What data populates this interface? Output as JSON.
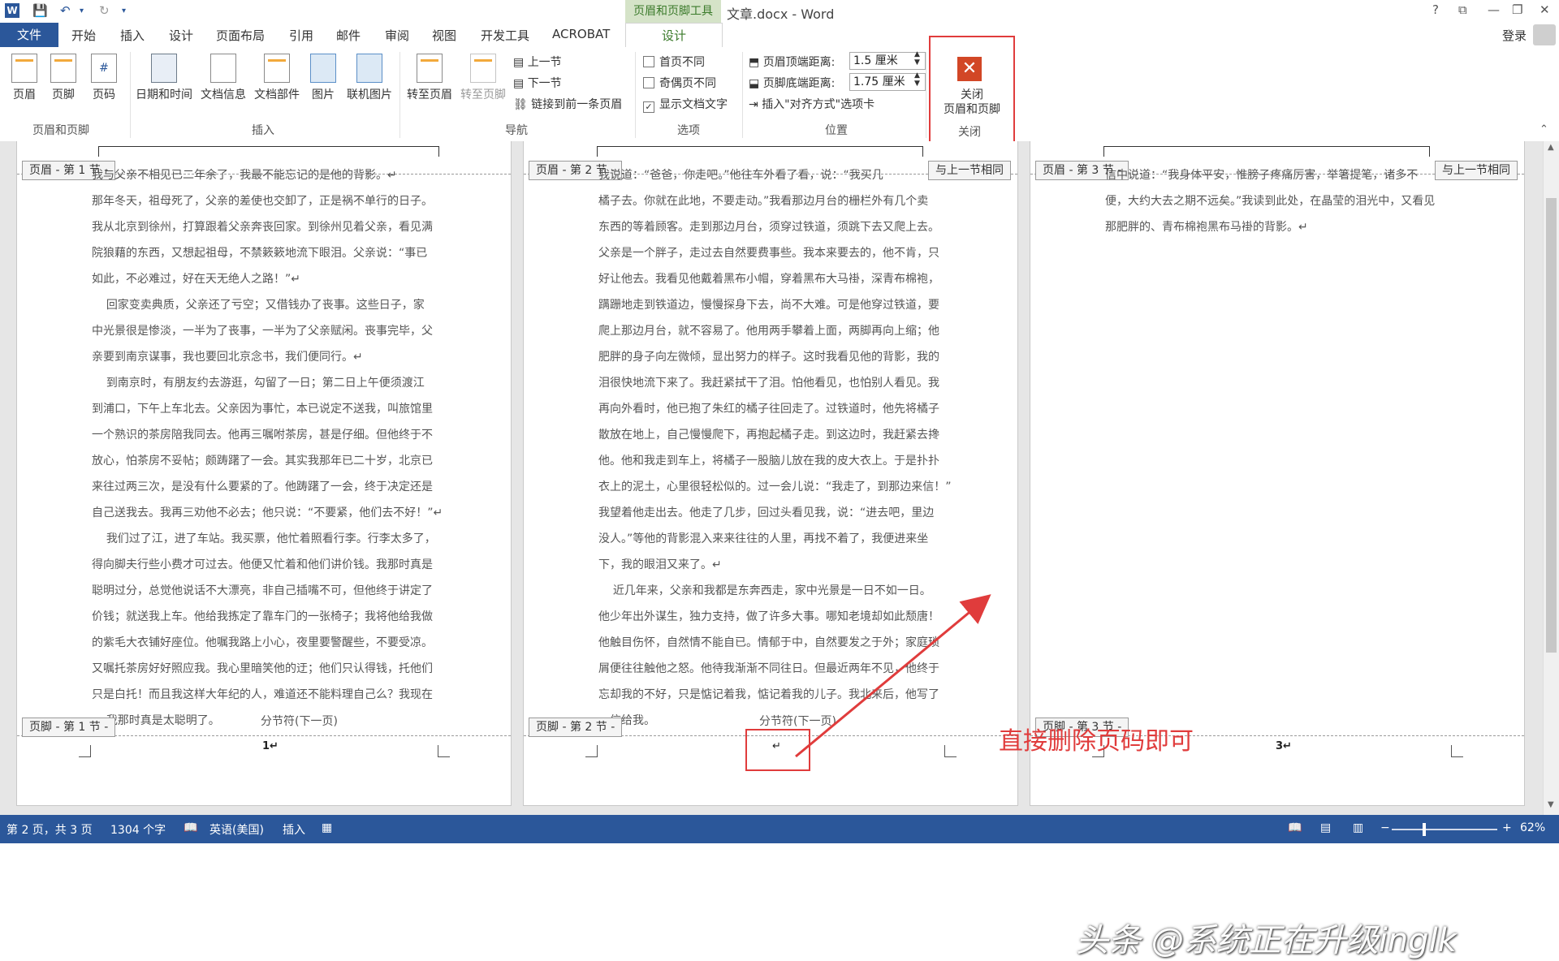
{
  "titlebar": {
    "title": "文章.docx - Word",
    "context_tab_title": "页眉和页脚工具",
    "help": "?",
    "restore_ribbon": "⧉",
    "minimize": "—",
    "maximize": "❐",
    "close": "✕"
  },
  "tabs": [
    {
      "label": "开始"
    },
    {
      "label": "插入"
    },
    {
      "label": "设计"
    },
    {
      "label": "页面布局"
    },
    {
      "label": "引用"
    },
    {
      "label": "邮件"
    },
    {
      "label": "审阅"
    },
    {
      "label": "视图"
    },
    {
      "label": "开发工具"
    },
    {
      "label": "ACROBAT"
    }
  ],
  "file_tab": "文件",
  "active_tab": "设计",
  "login": "登录",
  "ribbon": {
    "group_hf": {
      "label": "页眉和页脚",
      "header": "页眉",
      "footer": "页脚",
      "page_number": "页码"
    },
    "group_insert": {
      "label": "插入",
      "datetime": "日期和时间",
      "docinfo": "文档信息",
      "docparts": "文档部件",
      "picture": "图片",
      "online_picture": "联机图片"
    },
    "group_nav": {
      "label": "导航",
      "goto_header": "转至页眉",
      "goto_footer": "转至页脚",
      "prev_section": "上一节",
      "next_section": "下一节",
      "link_prev": "链接到前一条页眉"
    },
    "group_options": {
      "label": "选项",
      "diff_first": "首页不同",
      "diff_odd_even": "奇偶页不同",
      "show_doc_text": "显示文档文字"
    },
    "group_position": {
      "label": "位置",
      "header_from_top_label": "页眉顶端距离:",
      "header_from_top_value": "1.5 厘米",
      "footer_from_bottom_label": "页脚底端距离:",
      "footer_from_bottom_value": "1.75 厘米",
      "insert_align_tab": "插入\"对齐方式\"选项卡"
    },
    "group_close": {
      "label": "关闭",
      "close_line1": "关闭",
      "close_line2": "页眉和页脚"
    }
  },
  "pages": [
    {
      "header_tag": "页眉 - 第 1 节 -",
      "footer_tag": "页脚 - 第 1 节 -",
      "same_as_prev": "",
      "page_number": "1↵",
      "body": "我与父亲不相见已二年余了，我最不能忘记的是他的背影。↵\n那年冬天，祖母死了，父亲的差使也交卸了，正是祸不单行的日子。\n我从北京到徐州，打算跟着父亲奔丧回家。到徐州见着父亲，看见满\n院狼藉的东西，又想起祖母，不禁簌簌地流下眼泪。父亲说：“事已\n如此，不必难过，好在天无绝人之路！”↵\n    回家变卖典质，父亲还了亏空；又借钱办了丧事。这些日子，家\n中光景很是惨淡，一半为了丧事，一半为了父亲赋闲。丧事完毕，父\n亲要到南京谋事，我也要回北京念书，我们便同行。↵\n    到南京时，有朋友约去游逛，勾留了一日；第二日上午便须渡江\n到浦口，下午上车北去。父亲因为事忙，本已说定不送我，叫旅馆里\n一个熟识的茶房陪我同去。他再三嘱咐茶房，甚是仔细。但他终于不\n放心，怕茶房不妥帖；颇踌躇了一会。其实我那年已二十岁，北京已\n来往过两三次，是没有什么要紧的了。他踌躇了一会，终于决定还是\n自己送我去。我再三劝他不必去；他只说：“不要紧，他们去不好！”↵\n    我们过了江，进了车站。我买票，他忙着照看行李。行李太多了，\n得向脚夫行些小费才可过去。他便又忙着和他们讲价钱。我那时真是\n聪明过分，总觉他说话不大漂亮，非自己插嘴不可，但他终于讲定了\n价钱；就送我上车。他给我拣定了靠车门的一张椅子；我将他给我做\n的紫毛大衣铺好座位。他嘱我路上小心，夜里要警醒些，不要受凉。\n又嘱托茶房好好照应我。我心里暗笑他的迂；他们只认得钱，托他们\n只是白托！而且我这样大年纪的人，难道还不能料理自己么？我现在\n    我那时真是太聪明了。",
      "section_break": "分节符(下一页)"
    },
    {
      "header_tag": "页眉 - 第 2 节 -",
      "footer_tag": "页脚 - 第 2 节 -",
      "same_as_prev": "与上一节相同",
      "page_number": "↵",
      "body": "我说道：“爸爸，你走吧。”他往车外看了看，说：“我买几\n橘子去。你就在此地，不要走动。”我看那边月台的栅栏外有几个卖\n东西的等着顾客。走到那边月台，须穿过铁道，须跳下去又爬上去。\n父亲是一个胖子，走过去自然要费事些。我本来要去的，他不肯，只\n好让他去。我看见他戴着黑布小帽，穿着黑布大马褂，深青布棉袍，\n蹒跚地走到铁道边，慢慢探身下去，尚不大难。可是他穿过铁道，要\n爬上那边月台，就不容易了。他用两手攀着上面，两脚再向上缩；他\n肥胖的身子向左微倾，显出努力的样子。这时我看见他的背影，我的\n泪很快地流下来了。我赶紧拭干了泪。怕他看见，也怕别人看见。我\n再向外看时，他已抱了朱红的橘子往回走了。过铁道时，他先将橘子\n散放在地上，自己慢慢爬下，再抱起橘子走。到这边时，我赶紧去搀\n他。他和我走到车上，将橘子一股脑儿放在我的皮大衣上。于是扑扑\n衣上的泥土，心里很轻松似的。过一会儿说：“我走了，到那边来信！”\n我望着他走出去。他走了几步，回过头看见我，说：“进去吧，里边\n没人。”等他的背影混入来来往往的人里，再找不着了，我便进来坐\n下，我的眼泪又来了。↵\n    近几年来，父亲和我都是东奔西走，家中光景是一日不如一日。\n他少年出外谋生，独力支持，做了许多大事。哪知老境却如此颓唐！\n他触目伤怀，自然情不能自已。情郁于中，自然要发之于外；家庭琐\n屑便往往触他之怒。他待我渐渐不同往日。但最近两年不见，他终于\n忘却我的不好，只是惦记着我，惦记着我的儿子。我北来后，他写了\n一信给我。",
      "section_break": "分节符(下一页)"
    },
    {
      "header_tag": "页眉 - 第 3 节 -",
      "footer_tag": "页脚 - 第 3 节 -",
      "same_as_prev": "与上一节相同",
      "page_number": "3↵",
      "body": "信中说道：“我身体平安，惟膀子疼痛厉害，举箸提笔，诸多不\n便，大约大去之期不远矣。”我读到此处，在晶莹的泪光中，又看见\n那肥胖的、青布棉袍黑布马褂的背影。↵",
      "section_break": ""
    }
  ],
  "annotation": "直接删除页码即可",
  "watermark": "头条 @系统正在升级inglk",
  "statusbar": {
    "page": "第 2 页，共 3 页",
    "words": "1304 个字",
    "language": "英语(美国)",
    "mode": "插入",
    "zoom": "62%"
  }
}
